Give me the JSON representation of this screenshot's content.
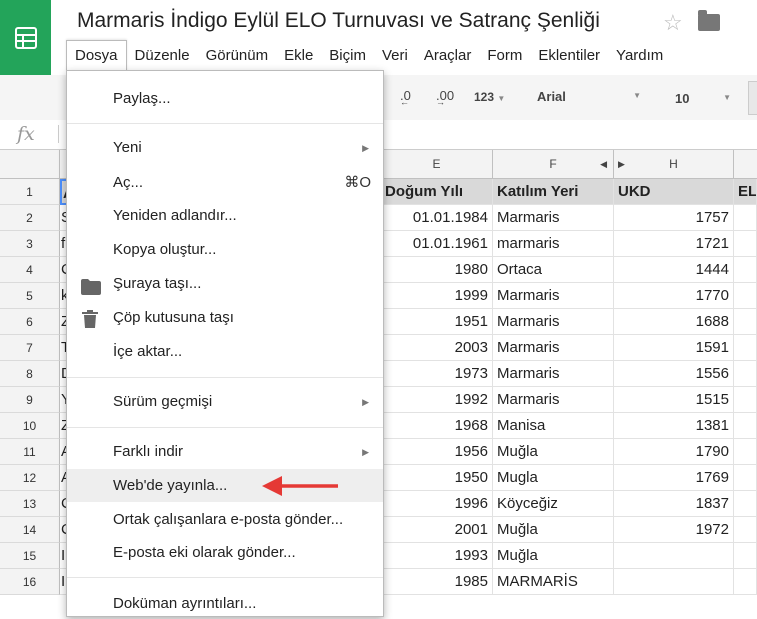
{
  "doc": {
    "title": "Marmaris İndigo Eylül ELO Turnuvası ve Satranç Şenliği"
  },
  "icons": {
    "logo": "sheets-logo-icon",
    "star": "star-icon",
    "folder": "folder-icon"
  },
  "menubar": [
    "Dosya",
    "Düzenle",
    "Görünüm",
    "Ekle",
    "Biçim",
    "Veri",
    "Araçlar",
    "Form",
    "Eklentiler",
    "Yardım"
  ],
  "toolbar": {
    "decrease_decimals": ".0",
    "increase_decimals": ".00",
    "format_more": "123",
    "font": "Arial",
    "font_size": "10"
  },
  "formula": {
    "fx": "fx",
    "value": ""
  },
  "columns": [
    "E",
    "F",
    "H"
  ],
  "rows": [
    {
      "n": "1",
      "a": "A",
      "e": "Doğum Yılı",
      "f": "Katılım Yeri",
      "h": "UKD",
      "i": "EL"
    },
    {
      "n": "2",
      "a": "S",
      "e": "01.01.1984",
      "f": "Marmaris",
      "h": "1757"
    },
    {
      "n": "3",
      "a": "f",
      "e": "01.01.1961",
      "f": "marmaris",
      "h": "1721"
    },
    {
      "n": "4",
      "a": "C",
      "e": "1980",
      "f": "Ortaca",
      "h": "1444"
    },
    {
      "n": "5",
      "a": "k",
      "e": "1999",
      "f": "Marmaris",
      "h": "1770"
    },
    {
      "n": "6",
      "a": "Z",
      "e": "1951",
      "f": "Marmaris",
      "h": "1688"
    },
    {
      "n": "7",
      "a": "T",
      "e": "2003",
      "f": "Marmaris",
      "h": "1591"
    },
    {
      "n": "8",
      "a": "D",
      "e": "1973",
      "f": "Marmaris",
      "h": "1556"
    },
    {
      "n": "9",
      "a": "Y",
      "e": "1992",
      "f": "Marmaris",
      "h": "1515"
    },
    {
      "n": "10",
      "a": "Z",
      "e": "1968",
      "f": "Manisa",
      "h": "1381"
    },
    {
      "n": "11",
      "a": "A",
      "e": "1956",
      "f": "Muğla",
      "h": "1790"
    },
    {
      "n": "12",
      "a": "A",
      "e": "1950",
      "f": "Mugla",
      "h": "1769"
    },
    {
      "n": "13",
      "a": "C",
      "e": "1996",
      "f": "Köyceğiz",
      "h": "1837"
    },
    {
      "n": "14",
      "a": "C",
      "e": "2001",
      "f": "Muğla",
      "h": "1972"
    },
    {
      "n": "15",
      "a": "I",
      "e": "1993",
      "f": "Muğla",
      "h": ""
    },
    {
      "n": "16",
      "a": "I",
      "e": "1985",
      "f": "MARMARİS",
      "h": ""
    }
  ],
  "file_menu": {
    "items": [
      {
        "label": "Paylaş..."
      },
      {
        "label": "Yeni",
        "submenu": true
      },
      {
        "label": "Aç...",
        "shortcut": "⌘O"
      },
      {
        "label": "Yeniden adlandır..."
      },
      {
        "label": "Kopya oluştur..."
      },
      {
        "label": "Şuraya taşı...",
        "icon": "folder-icon"
      },
      {
        "label": "Çöp kutusuna taşı",
        "icon": "trash-icon"
      },
      {
        "label": "İçe aktar..."
      },
      {
        "label": "Sürüm geçmişi",
        "submenu": true
      },
      {
        "label": "Farklı indir",
        "submenu": true
      },
      {
        "label": "Web'de yayınla...",
        "highlighted": true
      },
      {
        "label": "Ortak çalışanlara e-posta gönder..."
      },
      {
        "label": "E-posta eki olarak gönder..."
      },
      {
        "label": "Doküman ayrıntıları..."
      }
    ]
  },
  "annotation": {
    "arrow_color": "#e53935"
  }
}
